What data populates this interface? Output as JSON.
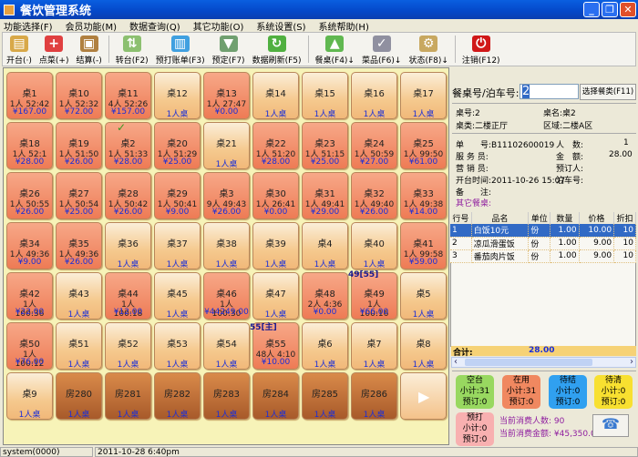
{
  "title": "餐饮管理系统",
  "menu": [
    "功能选择(F)",
    "会员功能(M)",
    "数据查询(Q)",
    "其它功能(O)",
    "系统设置(S)",
    "系统帮助(H)"
  ],
  "toolbar": [
    {
      "label": "开台(·)",
      "icon": "folder-icon",
      "color": "#d8a848",
      "glyph": "▤"
    },
    {
      "label": "点菜(+)",
      "icon": "plus-icon",
      "color": "#e04040",
      "glyph": "+"
    },
    {
      "label": "结算(-)",
      "icon": "checkout-icon",
      "color": "#b08040",
      "glyph": "▣"
    },
    {
      "label": "转台(F2)",
      "icon": "transfer-icon",
      "color": "#8cc070",
      "glyph": "⇅"
    },
    {
      "label": "预打账单(F3)",
      "icon": "printer-icon",
      "color": "#40a0e0",
      "glyph": "▥"
    },
    {
      "label": "预定(F7)",
      "icon": "cart-icon",
      "color": "#70a070",
      "glyph": "▼"
    },
    {
      "label": "数据刷新(F5)",
      "icon": "refresh-icon",
      "color": "#50b040",
      "glyph": "↻"
    },
    {
      "label": "餐桌(F4)↓",
      "icon": "up-arrow-icon",
      "color": "#60b850",
      "glyph": "▲"
    },
    {
      "label": "菜品(F6)↓",
      "icon": "printer-check-icon",
      "color": "#9090a0",
      "glyph": "✓"
    },
    {
      "label": "状态(F8)↓",
      "icon": "settings-doc-icon",
      "color": "#c8a860",
      "glyph": "⚙"
    },
    {
      "label": "注销(F12)",
      "icon": "power-icon",
      "color": "#d01818",
      "glyph": "⏻"
    }
  ],
  "tiles": [
    {
      "name": "桌1",
      "type": "busy",
      "info": "1人 52:42",
      "amount": "¥167.00"
    },
    {
      "name": "桌10",
      "type": "busy",
      "info": "1人 52:32",
      "amount": "¥72.00"
    },
    {
      "name": "桌11",
      "type": "busy",
      "info": "4人 52:26",
      "amount": "¥157.00"
    },
    {
      "name": "桌12",
      "type": "free",
      "amount": "1人桌"
    },
    {
      "name": "桌13",
      "type": "busy",
      "info": "1人 27:47",
      "amount": "¥0.00"
    },
    {
      "name": "桌14",
      "type": "free",
      "amount": "1人桌"
    },
    {
      "name": "桌15",
      "type": "free",
      "amount": "1人桌"
    },
    {
      "name": "桌16",
      "type": "free",
      "amount": "1人桌"
    },
    {
      "name": "桌17",
      "type": "free",
      "amount": "1人桌"
    },
    {
      "name": "桌18",
      "type": "busy",
      "info": "1人 52:1",
      "amount": "¥28.00"
    },
    {
      "name": "桌19",
      "type": "busy",
      "info": "1人 51:50",
      "amount": "¥26.00"
    },
    {
      "name": "桌2",
      "type": "busy",
      "info": "1人 51:33",
      "amount": "¥28.00",
      "check": "✓"
    },
    {
      "name": "桌20",
      "type": "busy",
      "info": "1人 51:29",
      "amount": "¥25.00"
    },
    {
      "name": "桌21",
      "type": "free",
      "amount": "1人桌"
    },
    {
      "name": "桌22",
      "type": "busy",
      "info": "1人 51:20",
      "amount": "¥28.00"
    },
    {
      "name": "桌23",
      "type": "busy",
      "info": "1人 51:15",
      "amount": "¥25.00"
    },
    {
      "name": "桌24",
      "type": "busy",
      "info": "1人 50:59",
      "amount": "¥27.00"
    },
    {
      "name": "桌25",
      "type": "busy",
      "info": "1人 99:50",
      "amount": "¥61.00"
    },
    {
      "name": "桌26",
      "type": "busy",
      "info": "1人 50:55",
      "amount": "¥26.00"
    },
    {
      "name": "桌27",
      "type": "busy",
      "info": "1人 50:54",
      "amount": "¥25.00"
    },
    {
      "name": "桌28",
      "type": "busy",
      "info": "1人 50:42",
      "amount": "¥26.00"
    },
    {
      "name": "桌29",
      "type": "busy",
      "info": "1人 50:41",
      "amount": "¥9.00"
    },
    {
      "name": "桌3",
      "type": "busy",
      "info": "9人 49:43",
      "amount": "¥26.00"
    },
    {
      "name": "桌30",
      "type": "busy",
      "info": "1人 26:41",
      "amount": "¥0.00"
    },
    {
      "name": "桌31",
      "type": "busy",
      "info": "1人 49:41",
      "amount": "¥29.00"
    },
    {
      "name": "桌32",
      "type": "busy",
      "info": "1人 49:40",
      "amount": "¥26.00"
    },
    {
      "name": "桌33",
      "type": "busy",
      "info": "1人 49:38",
      "amount": "¥14.00"
    },
    {
      "name": "桌34",
      "type": "busy",
      "info": "1人 49:36",
      "amount": "¥9.00"
    },
    {
      "name": "桌35",
      "type": "busy",
      "info": "1人 49:36",
      "amount": "¥26.00"
    },
    {
      "name": "桌36",
      "type": "free",
      "amount": "1人桌"
    },
    {
      "name": "桌37",
      "type": "free",
      "amount": "1人桌"
    },
    {
      "name": "桌38",
      "type": "free",
      "amount": "1人桌"
    },
    {
      "name": "桌39",
      "type": "free",
      "amount": "1人桌"
    },
    {
      "name": "桌4",
      "type": "free",
      "amount": "1人桌"
    },
    {
      "name": "桌40",
      "type": "free",
      "amount": "1人桌"
    },
    {
      "name": "桌41",
      "type": "busy",
      "info": "1人 99:58",
      "amount": "¥59.00"
    },
    {
      "name": "桌42",
      "type": "busy",
      "info": "1人 100:36",
      "amount": "¥22.00"
    },
    {
      "name": "桌43",
      "type": "free",
      "amount": "1人桌"
    },
    {
      "name": "桌44",
      "type": "busy",
      "info": "1人 100:18",
      "amount": "¥12.00"
    },
    {
      "name": "桌45",
      "type": "free",
      "amount": "1人桌"
    },
    {
      "name": "桌46",
      "type": "busy",
      "info": "1人 100:30",
      "amount": "¥44249.00"
    },
    {
      "name": "桌47",
      "type": "free",
      "amount": "1人桌"
    },
    {
      "name": "桌48",
      "type": "busy",
      "info": "2人 4:36",
      "amount": "¥0.00"
    },
    {
      "name": "桌49",
      "type": "busy",
      "info": "1人 100:16",
      "amount": "¥66.00",
      "tag": "49[55]"
    },
    {
      "name": "桌5",
      "type": "free",
      "amount": "1人桌"
    },
    {
      "name": "桌50",
      "type": "busy",
      "info": "1人 100:12",
      "amount": "¥76.00"
    },
    {
      "name": "桌51",
      "type": "free",
      "amount": "1人桌"
    },
    {
      "name": "桌52",
      "type": "free",
      "amount": "1人桌"
    },
    {
      "name": "桌53",
      "type": "free",
      "amount": "1人桌"
    },
    {
      "name": "桌54",
      "type": "free",
      "amount": "1人桌"
    },
    {
      "name": "桌55",
      "type": "busy",
      "info": "48人 4:10",
      "amount": "¥10.00",
      "tag": "55[主]"
    },
    {
      "name": "桌6",
      "type": "free",
      "amount": "1人桌"
    },
    {
      "name": "桌7",
      "type": "free",
      "amount": "1人桌"
    },
    {
      "name": "桌8",
      "type": "free",
      "amount": "1人桌"
    },
    {
      "name": "桌9",
      "type": "free",
      "amount": "1人桌"
    },
    {
      "name": "房280",
      "type": "room",
      "amount": "1人桌"
    },
    {
      "name": "房281",
      "type": "room",
      "amount": "1人桌"
    },
    {
      "name": "房282",
      "type": "room",
      "amount": "1人桌"
    },
    {
      "name": "房283",
      "type": "room",
      "amount": "1人桌"
    },
    {
      "name": "房284",
      "type": "room",
      "amount": "1人桌"
    },
    {
      "name": "房285",
      "type": "room",
      "amount": "1人桌"
    },
    {
      "name": "房286",
      "type": "room",
      "amount": "1人桌"
    },
    {
      "name": "",
      "type": "arrow",
      "glyph": "▶"
    }
  ],
  "panel": {
    "table_no_label": "餐桌号/泊车号:",
    "table_no_value": "2",
    "select_btn": "选择餐类(F11)",
    "zh_label": "桌号:2",
    "zm_label": "桌名:桌2",
    "zl_label": "桌类:二楼正厅",
    "qy_label": "区域:二楼A区",
    "order_no": "单　　号:B11102600019",
    "people_label": "人　数:",
    "people": "1",
    "waiter": "服 务 员:",
    "amount_label": "金　额:",
    "amount": "28.00",
    "sales": "营 销 员:",
    "booker": "预订人:",
    "open_time": "开台时间:2011-10-26 15:07",
    "parking": "泊车号:",
    "note": "备　　注:",
    "other_tables": "其它餐桌:"
  },
  "items": {
    "headers": [
      "行号",
      "品名",
      "单位",
      "数量",
      "价格",
      "折扣"
    ],
    "rows": [
      [
        "1",
        "白饭10元",
        "份",
        "1.00",
        "10.00",
        "10"
      ],
      [
        "2",
        "凉瓜滑蛋饭",
        "份",
        "1.00",
        "9.00",
        "10"
      ],
      [
        "3",
        "番茄肉片饭",
        "份",
        "1.00",
        "9.00",
        "10"
      ]
    ],
    "total_label": "合计:",
    "total": "28.00"
  },
  "stats": [
    {
      "label": "空台",
      "sub": "小计:31",
      "book": "预订:0",
      "color": "#98d860"
    },
    {
      "label": "在用",
      "sub": "小计:31",
      "book": "预订:0",
      "color": "#f08860"
    },
    {
      "label": "待结",
      "sub": "小计:0",
      "book": "预订:0",
      "color": "#30a0f0"
    },
    {
      "label": "待清",
      "sub": "小计:0",
      "book": "预订:0",
      "color": "#f8e030"
    },
    {
      "label": "预打",
      "sub": "小计:0",
      "book": "预订:0",
      "color": "#f8b0b0"
    }
  ],
  "summary": {
    "people": "当前消费人数: 90",
    "amount": "当前消费金额: ¥45,350.0"
  },
  "statusbar": {
    "user": "system(0000)",
    "time": "2011-10-28 6:40pm"
  }
}
